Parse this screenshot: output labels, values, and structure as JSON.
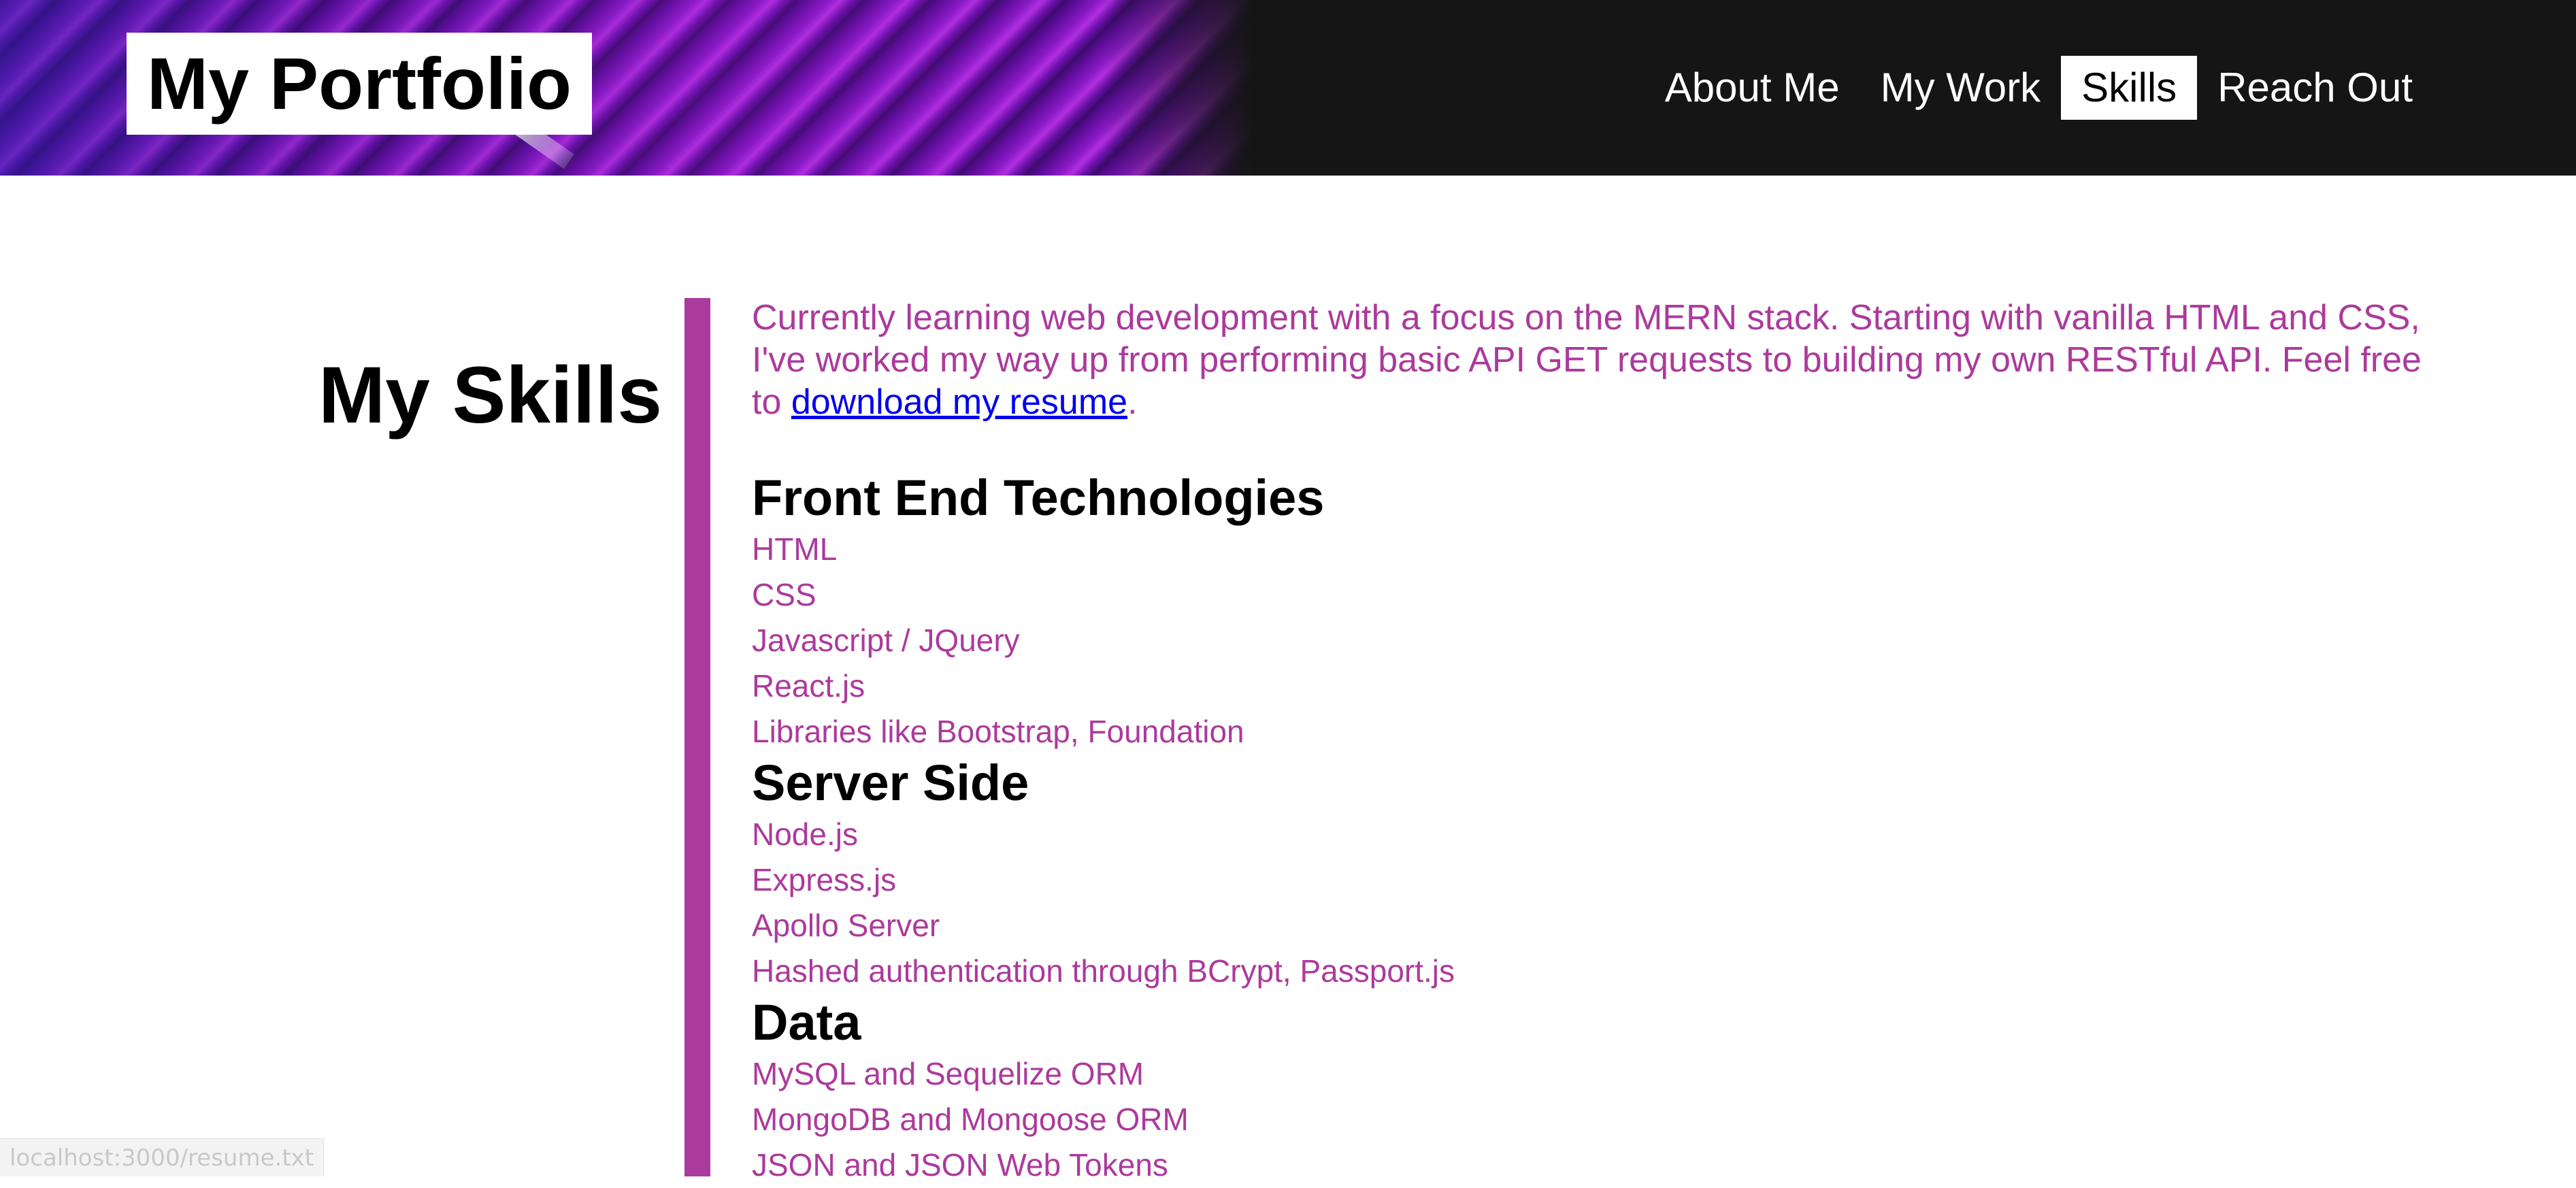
{
  "header": {
    "logo_text": "My Portfolio",
    "nav": [
      {
        "label": "About Me",
        "active": false
      },
      {
        "label": "My Work",
        "active": false
      },
      {
        "label": "Skills",
        "active": true
      },
      {
        "label": "Reach Out",
        "active": false
      }
    ]
  },
  "main": {
    "title": "My Skills",
    "intro_text": "Currently learning web development with a focus on the MERN stack. Starting with vanilla HTML and CSS, I've worked my way up from performing basic API GET requests to building my own RESTful API. Feel free to ",
    "resume_link": "download my resume",
    "intro_end": ".",
    "sections": [
      {
        "heading": "Front End Technologies",
        "items": [
          "HTML",
          "CSS",
          "Javascript / JQuery",
          "React.js",
          "Libraries like Bootstrap, Foundation"
        ]
      },
      {
        "heading": "Server Side",
        "items": [
          "Node.js",
          "Express.js",
          "Apollo Server",
          "Hashed authentication through BCrypt, Passport.js"
        ]
      },
      {
        "heading": "Data",
        "items": [
          "MySQL and Sequelize ORM",
          "MongoDB and Mongoose ORM",
          "JSON and JSON Web Tokens"
        ]
      }
    ]
  },
  "status_bar": {
    "url": "localhost:3000/resume.txt"
  },
  "colors": {
    "accent": "#ac3a9c",
    "header_bg": "#151515",
    "link": "#0000ee"
  }
}
